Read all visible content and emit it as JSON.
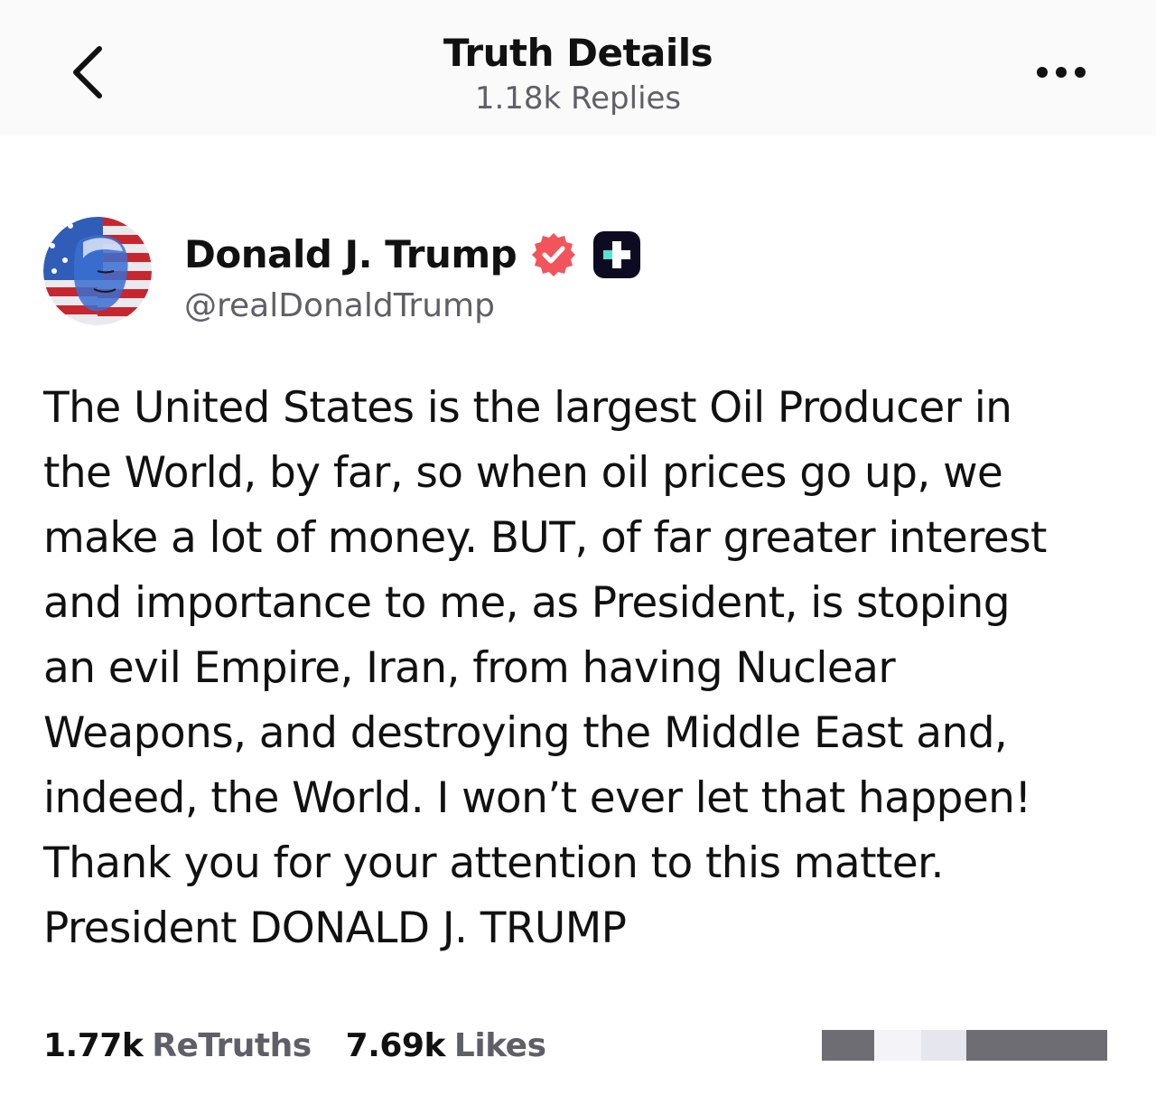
{
  "header": {
    "title": "Truth Details",
    "replies": "1.18k Replies",
    "back_icon": "chevron-left-icon",
    "more_icon": "more-horizontal-icon"
  },
  "author": {
    "name": "Donald J. Trump",
    "handle": "@realDonaldTrump",
    "verified_icon": "verified-badge-icon",
    "verified_color": "#f2545b",
    "plus_icon": "plus-badge-icon"
  },
  "post": {
    "lines": [
      "The United States is the largest Oil Producer in",
      "the World, by far, so when oil prices go up, we",
      "make a lot of money. BUT, of far greater interest",
      "and importance to me, as President, is stoping",
      "an evil Empire, Iran, from having Nuclear",
      "Weapons, and destroying the Middle East and,",
      "indeed, the World. I won’t ever let that happen!",
      "Thank you for your attention to this matter.",
      "President DONALD J. TRUMP"
    ]
  },
  "stats": {
    "retruths_count": "1.77k",
    "retruths_label": "ReTruths",
    "likes_count": "7.69k",
    "likes_label": "Likes"
  },
  "colors": {
    "text": "#111111",
    "muted": "#5f5f67",
    "header_bg": "#fafafa"
  }
}
